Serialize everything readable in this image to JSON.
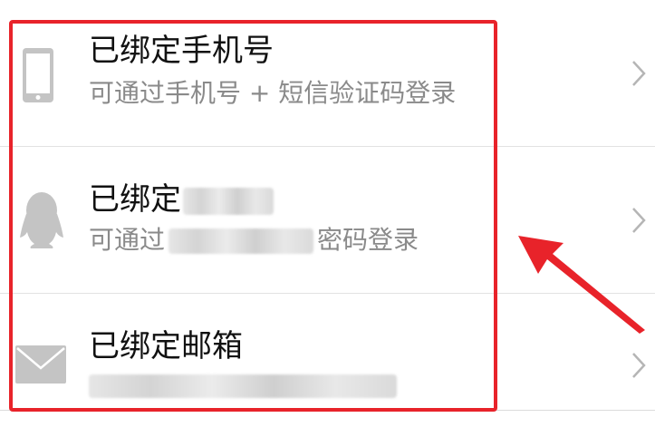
{
  "rows": [
    {
      "title": "已绑定手机号",
      "subtitle": "可通过手机号 + 短信验证码登录",
      "icon": "phone-icon"
    },
    {
      "title": "已绑定",
      "subtitle_prefix": "可通过",
      "subtitle_suffix": "密码登录",
      "icon": "qq-icon"
    },
    {
      "title": "已绑定邮箱",
      "icon": "mail-icon"
    }
  ],
  "colors": {
    "annotation": "#e8232a",
    "title": "#111111",
    "subtitle": "#8a8a8a",
    "icon": "#c4c4c4"
  }
}
